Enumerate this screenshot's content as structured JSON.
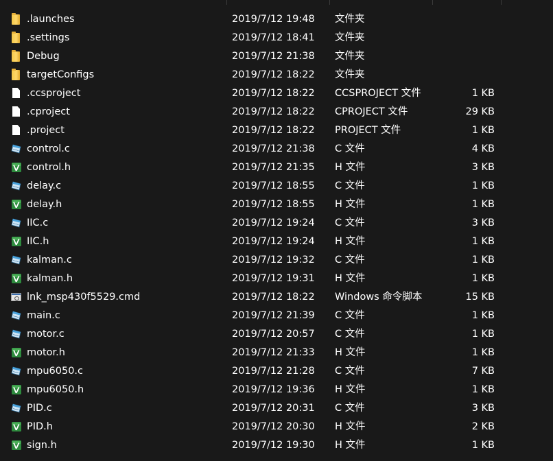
{
  "files": [
    {
      "name": ".launches",
      "date": "2019/7/12 19:48",
      "type": "文件夹",
      "size": "",
      "icon": "folder-icon"
    },
    {
      "name": ".settings",
      "date": "2019/7/12 18:41",
      "type": "文件夹",
      "size": "",
      "icon": "folder-icon"
    },
    {
      "name": "Debug",
      "date": "2019/7/12 21:38",
      "type": "文件夹",
      "size": "",
      "icon": "folder-icon"
    },
    {
      "name": "targetConfigs",
      "date": "2019/7/12 18:22",
      "type": "文件夹",
      "size": "",
      "icon": "folder-icon"
    },
    {
      "name": ".ccsproject",
      "date": "2019/7/12 18:22",
      "type": "CCSPROJECT 文件",
      "size": "1 KB",
      "icon": "document-icon"
    },
    {
      "name": ".cproject",
      "date": "2019/7/12 18:22",
      "type": "CPROJECT 文件",
      "size": "29 KB",
      "icon": "document-icon"
    },
    {
      "name": ".project",
      "date": "2019/7/12 18:22",
      "type": "PROJECT 文件",
      "size": "1 KB",
      "icon": "document-icon"
    },
    {
      "name": "control.c",
      "date": "2019/7/12 21:38",
      "type": "C 文件",
      "size": "4 KB",
      "icon": "c-file-icon"
    },
    {
      "name": "control.h",
      "date": "2019/7/12 21:35",
      "type": "H 文件",
      "size": "3 KB",
      "icon": "h-file-icon"
    },
    {
      "name": "delay.c",
      "date": "2019/7/12 18:55",
      "type": "C 文件",
      "size": "1 KB",
      "icon": "c-file-icon"
    },
    {
      "name": "delay.h",
      "date": "2019/7/12 18:55",
      "type": "H 文件",
      "size": "1 KB",
      "icon": "h-file-icon"
    },
    {
      "name": "IIC.c",
      "date": "2019/7/12 19:24",
      "type": "C 文件",
      "size": "3 KB",
      "icon": "c-file-icon"
    },
    {
      "name": "IIC.h",
      "date": "2019/7/12 19:24",
      "type": "H 文件",
      "size": "1 KB",
      "icon": "h-file-icon"
    },
    {
      "name": "kalman.c",
      "date": "2019/7/12 19:32",
      "type": "C 文件",
      "size": "1 KB",
      "icon": "c-file-icon"
    },
    {
      "name": "kalman.h",
      "date": "2019/7/12 19:31",
      "type": "H 文件",
      "size": "1 KB",
      "icon": "h-file-icon"
    },
    {
      "name": "lnk_msp430f5529.cmd",
      "date": "2019/7/12 18:22",
      "type": "Windows 命令脚本",
      "size": "15 KB",
      "icon": "cmd-script-icon"
    },
    {
      "name": "main.c",
      "date": "2019/7/12 21:39",
      "type": "C 文件",
      "size": "1 KB",
      "icon": "c-file-icon"
    },
    {
      "name": "motor.c",
      "date": "2019/7/12 20:57",
      "type": "C 文件",
      "size": "1 KB",
      "icon": "c-file-icon"
    },
    {
      "name": "motor.h",
      "date": "2019/7/12 21:33",
      "type": "H 文件",
      "size": "1 KB",
      "icon": "h-file-icon"
    },
    {
      "name": "mpu6050.c",
      "date": "2019/7/12 21:28",
      "type": "C 文件",
      "size": "7 KB",
      "icon": "c-file-icon"
    },
    {
      "name": "mpu6050.h",
      "date": "2019/7/12 19:36",
      "type": "H 文件",
      "size": "1 KB",
      "icon": "h-file-icon"
    },
    {
      "name": "PID.c",
      "date": "2019/7/12 20:31",
      "type": "C 文件",
      "size": "3 KB",
      "icon": "c-file-icon"
    },
    {
      "name": "PID.h",
      "date": "2019/7/12 20:30",
      "type": "H 文件",
      "size": "2 KB",
      "icon": "h-file-icon"
    },
    {
      "name": "sign.h",
      "date": "2019/7/12 19:30",
      "type": "H 文件",
      "size": "1 KB",
      "icon": "h-file-icon"
    }
  ],
  "colors": {
    "background": "#191919",
    "text": "#ffffff",
    "folder": "#ffd869",
    "c_file": "#5aa6d6",
    "h_file": "#2e8b3e"
  }
}
